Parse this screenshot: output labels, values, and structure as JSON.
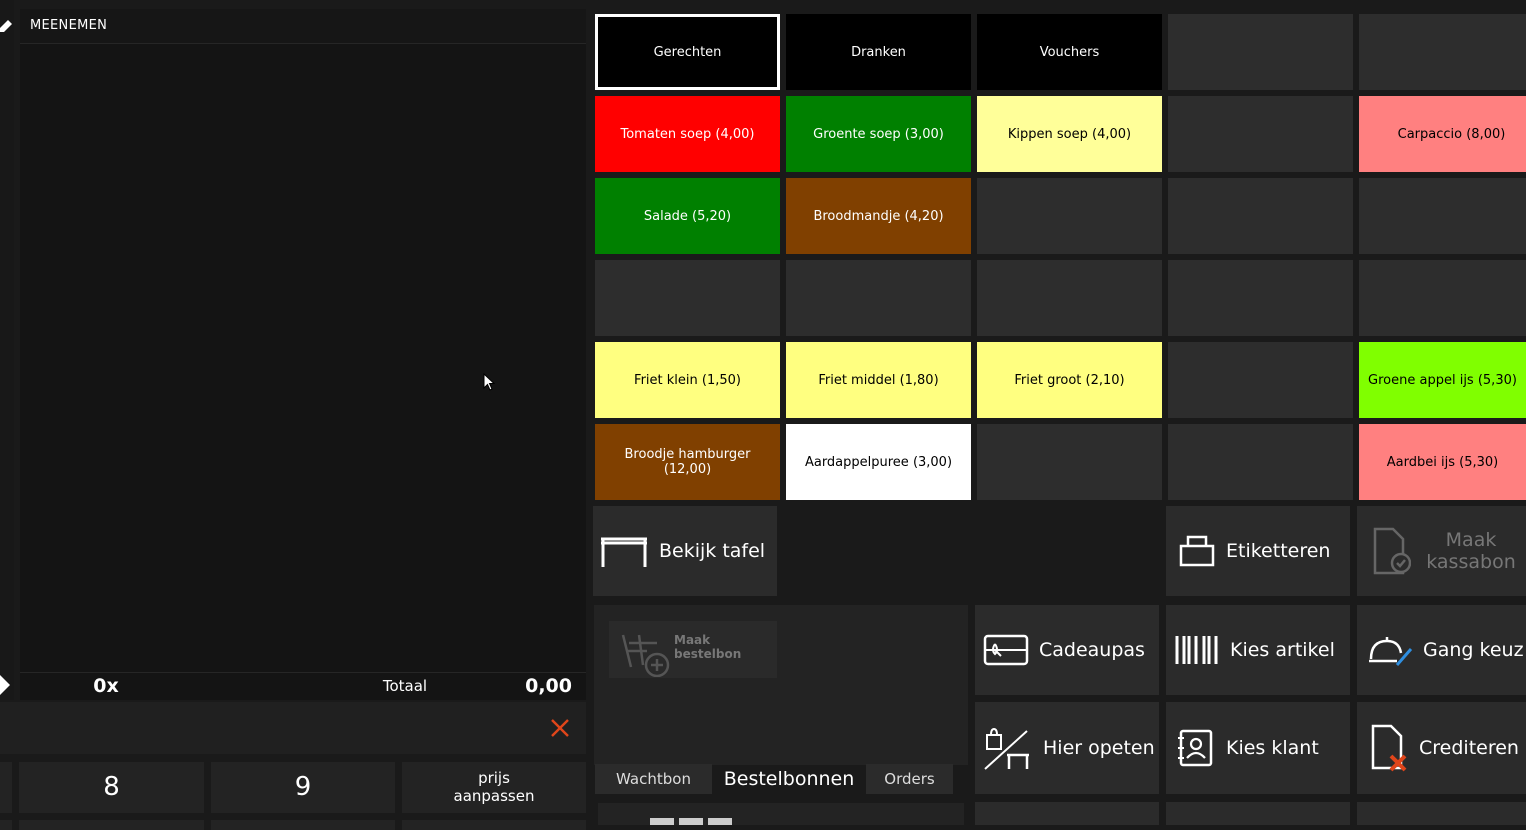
{
  "order": {
    "header": "MEENEMEN",
    "quantity": "0x",
    "total_label": "Totaal",
    "total_value": "0,00"
  },
  "keypad": {
    "key_8": "8",
    "key_9": "9",
    "price_line1": "prijs",
    "price_line2": "aanpassen"
  },
  "categories": [
    {
      "label": "Gerechten",
      "selected": true
    },
    {
      "label": "Dranken"
    },
    {
      "label": "Vouchers"
    }
  ],
  "products": [
    {
      "label": "Tomaten soep (4,00)",
      "color": "#ff0000",
      "text": "#ffffff"
    },
    {
      "label": "Groente soep (3,00)",
      "color": "#008000",
      "text": "#ffffff"
    },
    {
      "label": "Kippen soep (4,00)",
      "color": "#ffff99",
      "text": "#000000"
    },
    {
      "label": "Carpaccio (8,00)",
      "color": "#ff8080",
      "text": "#000000"
    },
    {
      "label": "Salade (5,20)",
      "color": "#008000",
      "text": "#ffffff"
    },
    {
      "label": "Broodmandje (4,20)",
      "color": "#804000",
      "text": "#ffffff"
    },
    {
      "label": "Friet klein (1,50)",
      "color": "#ffff80",
      "text": "#000000"
    },
    {
      "label": "Friet middel (1,80)",
      "color": "#ffff80",
      "text": "#000000"
    },
    {
      "label": "Friet groot (2,10)",
      "color": "#ffff80",
      "text": "#000000"
    },
    {
      "label": "Groene appel ijs (5,30)",
      "color": "#80ff00",
      "text": "#000000"
    },
    {
      "label": "Broodje hamburger (12,00)",
      "color": "#804000",
      "text": "#ffffff"
    },
    {
      "label": "Aardappelpuree (3,00)",
      "color": "#ffffff",
      "text": "#000000"
    },
    {
      "label": "Aardbei ijs (5,30)",
      "color": "#ff8080",
      "text": "#000000"
    }
  ],
  "actions": {
    "bekijk_tafel": "Bekijk tafel",
    "etiketteren": "Etiketteren",
    "maak_kassabon": "Maak kassabon",
    "maak_bestelbon": "Maak bestelbon",
    "cadeaupas": "Cadeaupas",
    "kies_artikel": "Kies artikel",
    "gang_keuze": "Gang keuz",
    "hier_opeten": "Hier opeten",
    "kies_klant": "Kies klant",
    "crediteren": "Crediteren"
  },
  "tabs": [
    "Wachtbon",
    "Bestelbonnen",
    "Orders"
  ],
  "colors": {
    "accent_close": "#e0451a",
    "selected_border": "#ffffff"
  }
}
